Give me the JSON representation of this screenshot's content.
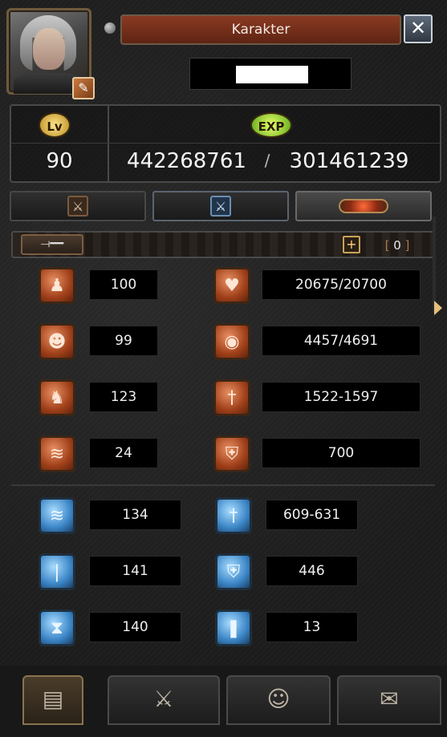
{
  "window": {
    "title": "Karakter",
    "close_icon": "close-icon"
  },
  "character": {
    "level_badge": "Lv",
    "exp_badge": "EXP",
    "level": "90",
    "exp_current": "442268761",
    "exp_separator": "/",
    "exp_required": "301461239"
  },
  "tabs": [
    {
      "icon": "crossed-swords-icon"
    },
    {
      "icon": "crossed-swords-blue-icon"
    },
    {
      "icon": "gem-ornament-icon"
    }
  ],
  "statbar": {
    "sword_icon": "sword-icon",
    "plus_label": "+",
    "points": "0"
  },
  "primary_stats": [
    {
      "icon": "body-icon",
      "value": "100"
    },
    {
      "icon": "head-icon",
      "value": "99"
    },
    {
      "icon": "foot-icon",
      "value": "123"
    },
    {
      "icon": "agility-icon",
      "value": "24"
    }
  ],
  "derived_stats": [
    {
      "icon": "heart-icon",
      "value": "20675/20700"
    },
    {
      "icon": "mana-icon",
      "value": "4457/4691"
    },
    {
      "icon": "attack-icon",
      "value": "1522-1597"
    },
    {
      "icon": "defense-icon",
      "value": "700"
    }
  ],
  "secondary_left": [
    {
      "icon": "move-speed-icon",
      "value": "134"
    },
    {
      "icon": "attack-speed-icon",
      "value": "141"
    },
    {
      "icon": "cast-speed-icon",
      "value": "140"
    }
  ],
  "secondary_right": [
    {
      "icon": "magic-attack-icon",
      "value": "609-631"
    },
    {
      "icon": "magic-defense-icon",
      "value": "446"
    },
    {
      "icon": "hit-icon",
      "value": "13"
    }
  ],
  "bottom_tabs": [
    {
      "icon": "character-card-icon"
    },
    {
      "icon": "skill-sword-icon"
    },
    {
      "icon": "emote-icon"
    },
    {
      "icon": "quest-scroll-icon"
    }
  ],
  "colors": {
    "title_bg": "#8a3a22",
    "red_icon": "#a0401a",
    "blue_icon": "#3b86c7",
    "value_box": "#000000"
  }
}
